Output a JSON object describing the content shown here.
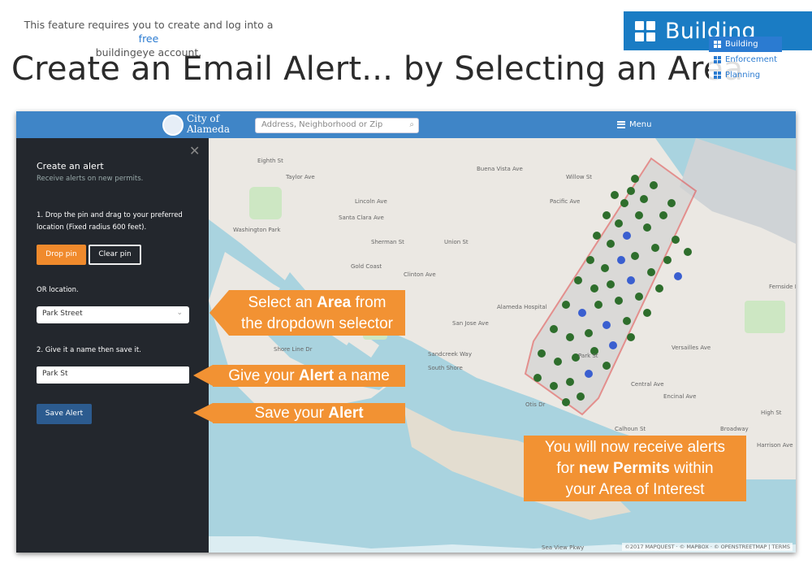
{
  "header": {
    "note_prefix": "This feature requires you to create and log into a",
    "note_link": "free",
    "note_suffix": "buildingeye account.",
    "badge_label": "Building",
    "title": "Create an Email Alert... by Selecting an Area"
  },
  "app": {
    "city_line1": "City of",
    "city_line2": "Alameda",
    "search_placeholder": "Address, Neighborhood or Zip",
    "menu_label": "Menu"
  },
  "sidebar": {
    "close_glyph": "✕",
    "title": "Create an alert",
    "subtitle": "Receive alerts on new permits.",
    "step1": "1. Drop the pin and drag to your preferred location (Fixed radius 600 feet).",
    "drop_pin_label": "Drop pin",
    "clear_pin_label": "Clear pin",
    "or_location_label": "OR location.",
    "location_value": "Park Street",
    "step2": "2. Give it a name then save it.",
    "name_value": "Park St",
    "save_label": "Save Alert"
  },
  "layers": [
    {
      "label": "Building",
      "active": true
    },
    {
      "label": "Enforcement",
      "active": false
    },
    {
      "label": "Planning",
      "active": false
    }
  ],
  "map": {
    "attribution": "©2017 MAPQUEST · © MAPBOX · © OPENSTREETMAP | TERMS",
    "labels": [
      "Taylor Ave",
      "Santa Clara Ave",
      "Lincoln Ave",
      "Pacific Ave",
      "Buena Vista Ave",
      "Clinton Ave",
      "San Jose Ave",
      "Sandcreek Way",
      "Washington Park",
      "Gold Coast",
      "Park St",
      "Otis Dr",
      "Shore Line Dr",
      "Encinal Ave",
      "Versailles Ave",
      "Calhoun St",
      "High St",
      "Fernside Blvd",
      "Harrison Ave",
      "Central Ave",
      "Eighth St",
      "Sherman St",
      "Union St",
      "Willow St",
      "Broadway",
      "Alameda Hospital",
      "South Shore",
      "Sea View Pkwy"
    ]
  },
  "callouts": {
    "area_a": "Select an ",
    "area_b": "Area",
    "area_c": " from",
    "area_d": "the dropdown selector",
    "name_a": "Give your ",
    "name_b": "Alert",
    "name_c": " a name",
    "save_a": "Save your ",
    "save_b": "Alert",
    "result_line1": "You will now receive alerts",
    "result_a": "for ",
    "result_b": "new Permits",
    "result_c": " within",
    "result_line3": "your Area of Interest"
  },
  "colors": {
    "brand_blue": "#1a7cc4",
    "callout_orange": "#f29233",
    "sidebar_bg": "#23272d",
    "marker_green": "#2e6e2c",
    "marker_blue": "#3a5fd0",
    "area_outline": "#e06060"
  }
}
